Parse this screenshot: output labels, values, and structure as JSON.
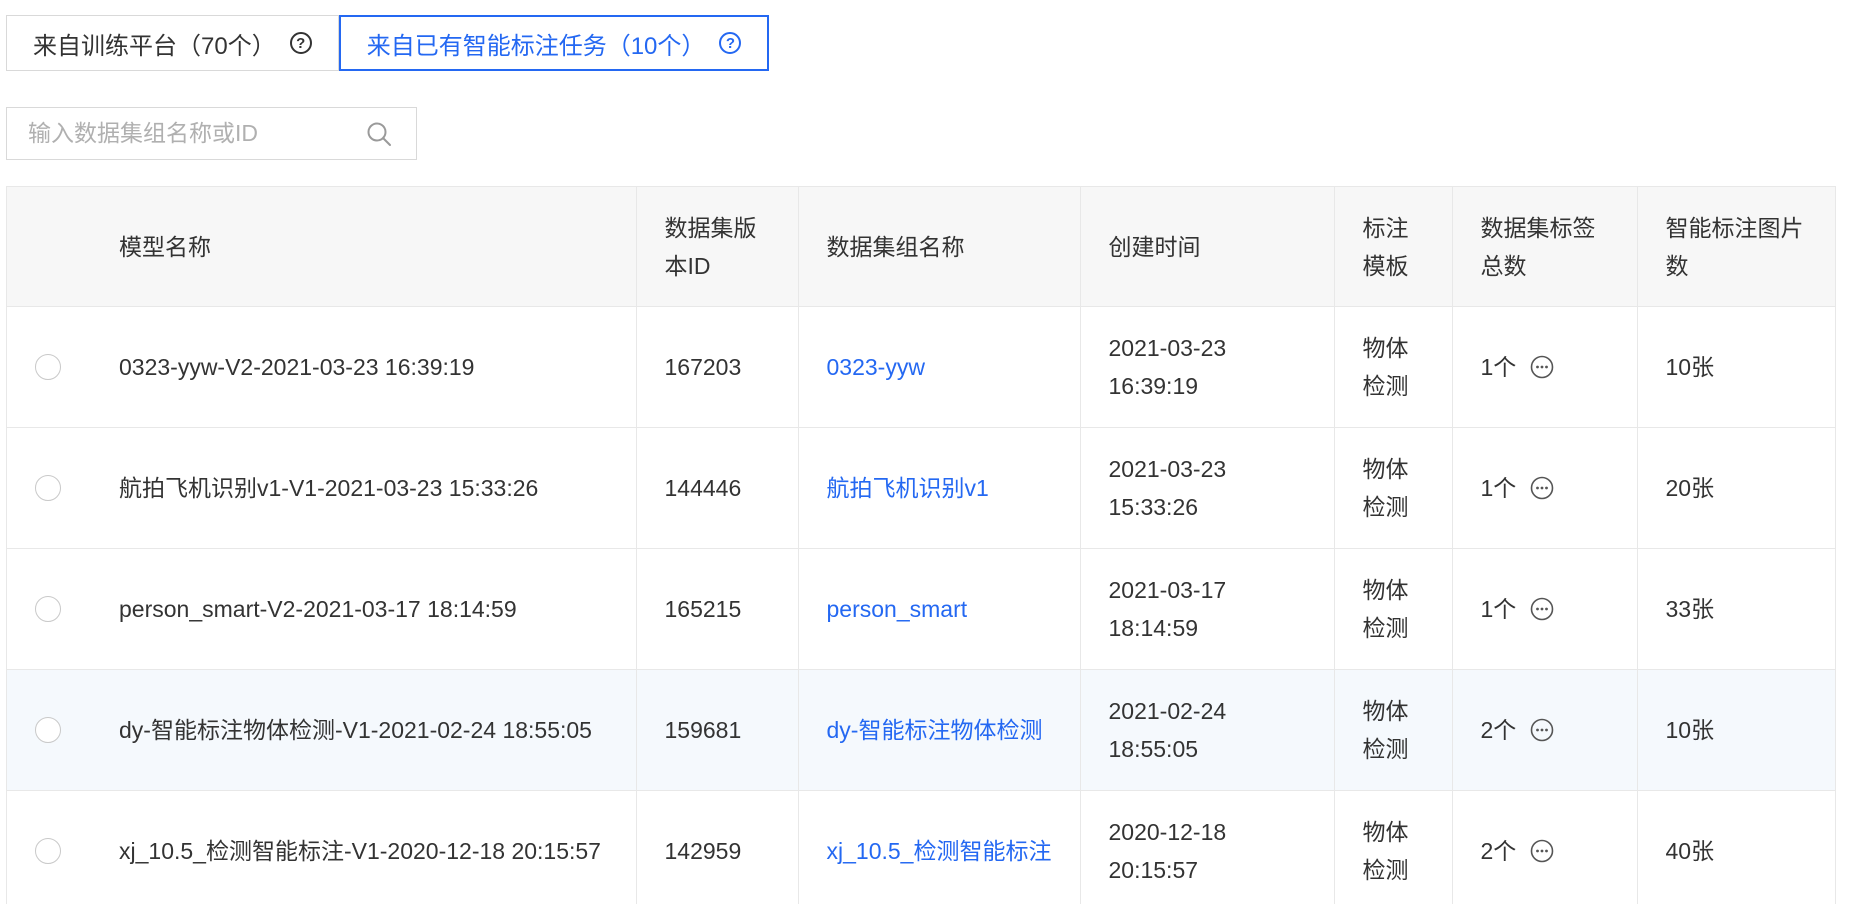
{
  "tabs": [
    {
      "label": "来自训练平台（70个）",
      "active": false
    },
    {
      "label": "来自已有智能标注任务（10个）",
      "active": true
    }
  ],
  "search": {
    "placeholder": "输入数据集组名称或ID",
    "value": ""
  },
  "colors": {
    "accent": "#2468f2",
    "header_bg": "#f7f7f7",
    "hover_row_bg": "#f5f9fd",
    "border": "#e8e8e8"
  },
  "icons": {
    "help": "question-circle-icon",
    "search": "magnifier-icon",
    "more": "ellipsis-circle-icon",
    "select": "radio-icon"
  },
  "table": {
    "headers": [
      "模型名称",
      "数据集版本ID",
      "数据集组名称",
      "创建时间",
      "标注模板",
      "数据集标签总数",
      "智能标注图片数"
    ],
    "rows": [
      {
        "model": "0323-yyw-V2-2021-03-23 16:39:19",
        "version_id": "167203",
        "group": "0323-yyw",
        "created": "2021-03-23 16:39:19",
        "template": "物体检测",
        "tags": "1个",
        "images": "10张"
      },
      {
        "model": "航拍飞机识别v1-V1-2021-03-23 15:33:26",
        "version_id": "144446",
        "group": "航拍飞机识别v1",
        "created": "2021-03-23 15:33:26",
        "template": "物体检测",
        "tags": "1个",
        "images": "20张"
      },
      {
        "model": "person_smart-V2-2021-03-17 18:14:59",
        "version_id": "165215",
        "group": "person_smart",
        "created": "2021-03-17 18:14:59",
        "template": "物体检测",
        "tags": "1个",
        "images": "33张"
      },
      {
        "model": "dy-智能标注物体检测-V1-2021-02-24 18:55:05",
        "version_id": "159681",
        "group": "dy-智能标注物体检测",
        "created": "2021-02-24 18:55:05",
        "template": "物体检测",
        "tags": "2个",
        "images": "10张"
      },
      {
        "model": "xj_10.5_检测智能标注-V1-2020-12-18 20:15:57",
        "version_id": "142959",
        "group": "xj_10.5_检测智能标注",
        "created": "2020-12-18 20:15:57",
        "template": "物体检测",
        "tags": "2个",
        "images": "40张"
      }
    ]
  }
}
